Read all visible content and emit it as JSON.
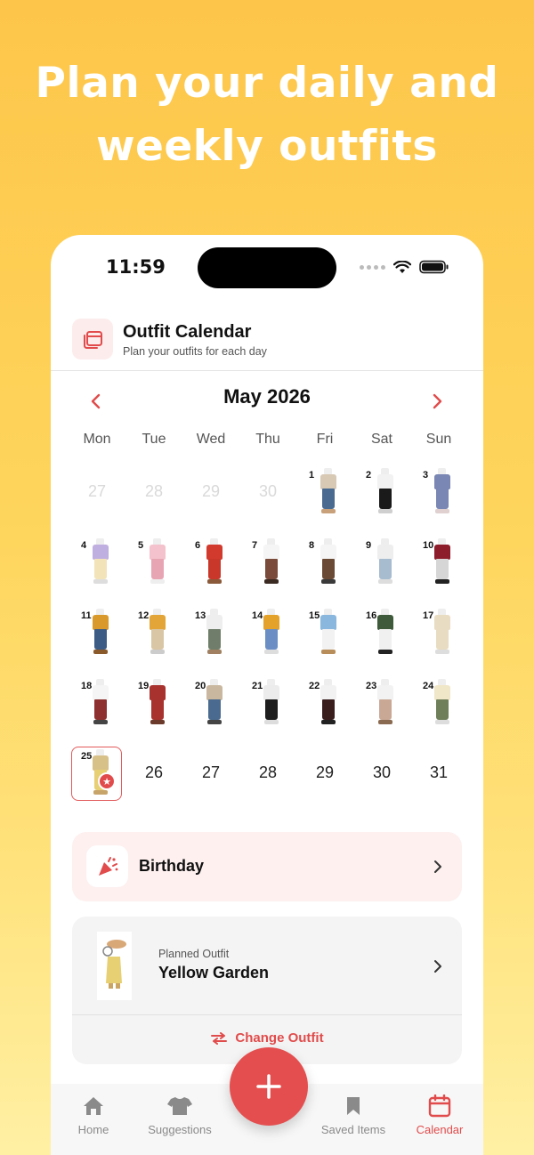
{
  "headline": {
    "line1": "Plan your daily and",
    "line2": "weekly outfits"
  },
  "status_bar": {
    "time": "11:59"
  },
  "header": {
    "title": "Outfit Calendar",
    "subtitle": "Plan your outfits for each day"
  },
  "calendar": {
    "month_label": "May 2026",
    "weekdays": [
      "Mon",
      "Tue",
      "Wed",
      "Thu",
      "Fri",
      "Sat",
      "Sun"
    ],
    "selected_day": "25",
    "rows": [
      [
        {
          "day": "27",
          "outside": true
        },
        {
          "day": "28",
          "outside": true
        },
        {
          "day": "29",
          "outside": true
        },
        {
          "day": "30",
          "outside": true
        },
        {
          "day": "1",
          "outfit": [
            "#d8c9b5",
            "#4a6b8f",
            "#c8a07a"
          ]
        },
        {
          "day": "2",
          "outfit": [
            "#f2f2f2",
            "#1a1a1a",
            "#cfcfcf"
          ]
        },
        {
          "day": "3",
          "outfit": [
            "#7a86b3",
            "#7a86b3",
            "#e0d0d0"
          ]
        }
      ],
      [
        {
          "day": "4",
          "outfit": [
            "#bfaee0",
            "#f2e4b8",
            "#dddddd"
          ]
        },
        {
          "day": "5",
          "outfit": [
            "#f4c2cc",
            "#e7a5b3",
            "#eeeeee"
          ]
        },
        {
          "day": "6",
          "outfit": [
            "#d23a2e",
            "#c9362a",
            "#8b5a3a"
          ]
        },
        {
          "day": "7",
          "outfit": [
            "#f5f5f5",
            "#7a4a3a",
            "#3a2a22"
          ]
        },
        {
          "day": "8",
          "outfit": [
            "#f5f5f5",
            "#6b4a35",
            "#3a3a3a"
          ]
        },
        {
          "day": "9",
          "outfit": [
            "#eeeeee",
            "#a7bccf",
            "#dddddd"
          ]
        },
        {
          "day": "10",
          "outfit": [
            "#8d1d2a",
            "#d6d6d6",
            "#222222"
          ]
        }
      ],
      [
        {
          "day": "11",
          "outfit": [
            "#d99a2b",
            "#3d5c85",
            "#8b5a2b"
          ]
        },
        {
          "day": "12",
          "outfit": [
            "#e3a537",
            "#d9c6a5",
            "#cccccc"
          ]
        },
        {
          "day": "13",
          "outfit": [
            "#eeeeee",
            "#6f7d6a",
            "#a08060"
          ]
        },
        {
          "day": "14",
          "outfit": [
            "#e5a22b",
            "#6b8fc5",
            "#dddddd"
          ]
        },
        {
          "day": "15",
          "outfit": [
            "#89b7dd",
            "#f2f2f2",
            "#b88d5a"
          ]
        },
        {
          "day": "16",
          "outfit": [
            "#3f5a3a",
            "#f0f0f0",
            "#222222"
          ]
        },
        {
          "day": "17",
          "outfit": [
            "#e8dcc2",
            "#e8dcc2",
            "#dddddd"
          ]
        }
      ],
      [
        {
          "day": "18",
          "outfit": [
            "#f5f5f5",
            "#8e3030",
            "#444444"
          ]
        },
        {
          "day": "19",
          "outfit": [
            "#a8322e",
            "#a8322e",
            "#6b3a2a"
          ]
        },
        {
          "day": "20",
          "outfit": [
            "#c9b89f",
            "#4a6b8f",
            "#444444"
          ]
        },
        {
          "day": "21",
          "outfit": [
            "#ececec",
            "#1e1e1e",
            "#dddddd"
          ]
        },
        {
          "day": "22",
          "outfit": [
            "#f2f2f2",
            "#3a1e1e",
            "#222222"
          ]
        },
        {
          "day": "23",
          "outfit": [
            "#f2f2f2",
            "#c9a996",
            "#8a6a50"
          ]
        },
        {
          "day": "24",
          "outfit": [
            "#f0e6c8",
            "#6f7f5a",
            "#dddddd"
          ]
        }
      ],
      [
        {
          "day": "25",
          "outfit": [
            "#d8c089",
            "#e7cf73",
            "#c7a56a"
          ],
          "selected": true
        },
        {
          "day": "26"
        },
        {
          "day": "27"
        },
        {
          "day": "28"
        },
        {
          "day": "29"
        },
        {
          "day": "30"
        },
        {
          "day": "31"
        }
      ]
    ]
  },
  "event": {
    "label": "Birthday",
    "icon": "party-popper-icon"
  },
  "planned": {
    "caption": "Planned Outfit",
    "name": "Yellow Garden",
    "change_label": "Change Outfit"
  },
  "tabbar": {
    "home": "Home",
    "suggestions": "Suggestions",
    "saved": "Saved Items",
    "calendar": "Calendar"
  },
  "colors": {
    "accent": "#e14b4b",
    "accent_light": "#fdf0ef",
    "background_top": "#fdc64a",
    "background_bottom": "#fff0a4"
  }
}
